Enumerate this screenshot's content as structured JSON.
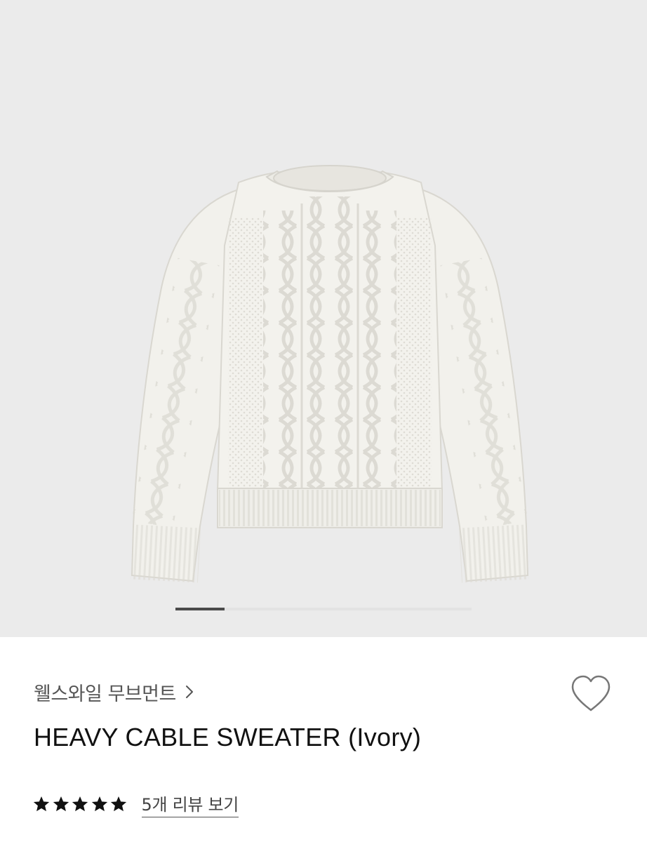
{
  "product": {
    "brand": "웰스와일 무브먼트",
    "title": "HEAVY CABLE SWEATER (Ivory)",
    "rating": 5,
    "rating_max": 5,
    "review_link": "5개 리뷰 보기"
  },
  "gallery": {
    "current_slide": 1,
    "progress_fraction": 0.166
  },
  "icons": {
    "chevron": "chevron-right-icon",
    "wishlist": "heart-outline-icon",
    "star": "star-filled-icon"
  },
  "colors": {
    "image_background": "#ebebeb",
    "sweater": "#f2f1ec",
    "star": "#111111",
    "pager_active": "#4a4a4a"
  }
}
